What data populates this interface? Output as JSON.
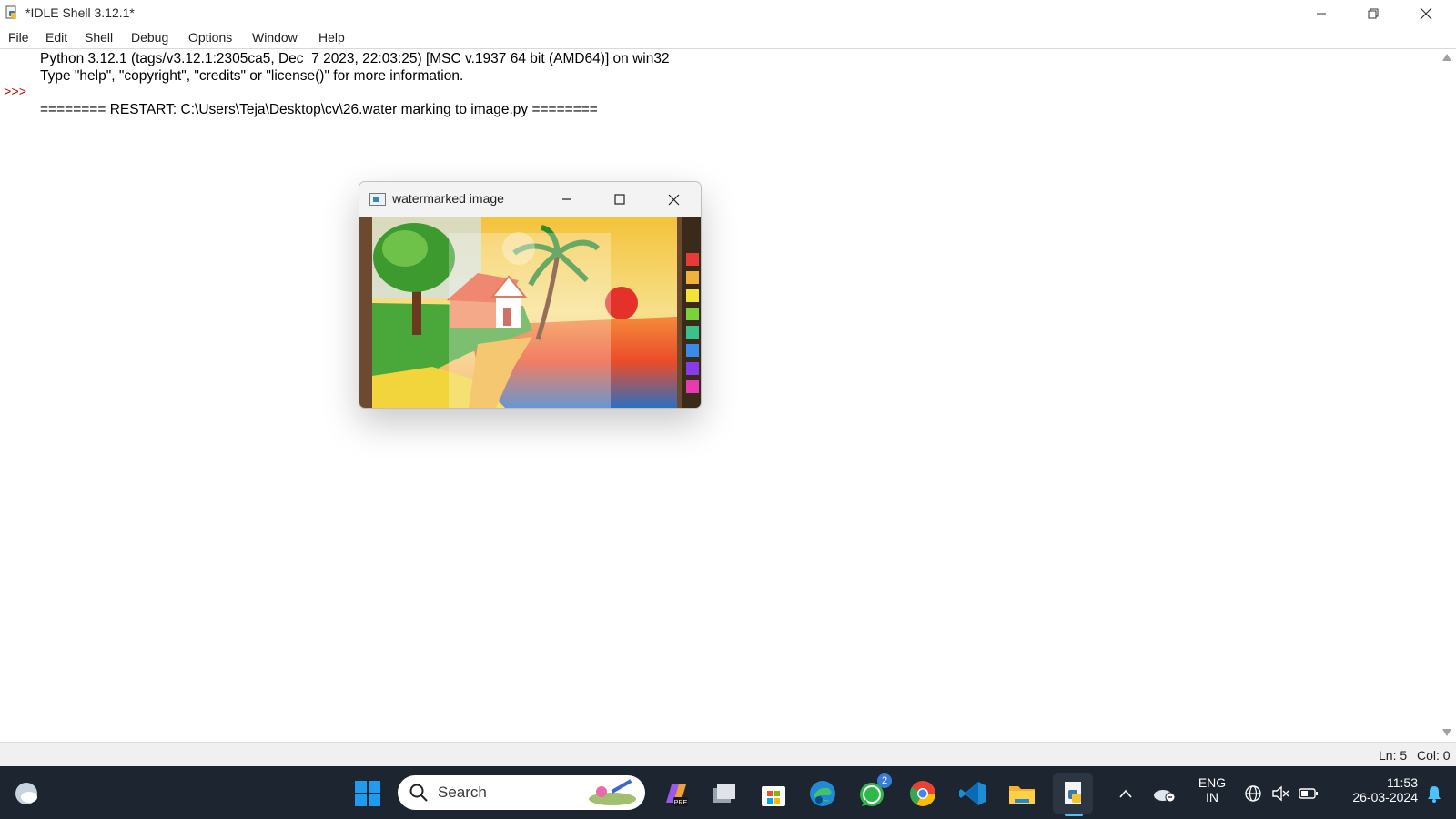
{
  "window": {
    "title": "*IDLE Shell 3.12.1*"
  },
  "menu": [
    "File",
    "Edit",
    "Shell",
    "Debug",
    "Options",
    "Window",
    "Help"
  ],
  "shell": {
    "prompt": ">>>",
    "lines": [
      "Python 3.12.1 (tags/v3.12.1:2305ca5, Dec  7 2023, 22:03:25) [MSC v.1937 64 bit (AMD64)] on win32",
      "Type \"help\", \"copyright\", \"credits\" or \"license()\" for more information.",
      "======== RESTART: C:\\Users\\Teja\\Desktop\\cv\\26.water marking to image.py ========"
    ]
  },
  "status": {
    "ln": "Ln: 5",
    "col": "Col: 0"
  },
  "popup": {
    "title": "watermarked image"
  },
  "taskbar": {
    "search_label": "Search",
    "whatsapp_badge": "2",
    "language_top": "ENG",
    "language_bottom": "IN",
    "time": "11:53",
    "date": "26-03-2024"
  }
}
